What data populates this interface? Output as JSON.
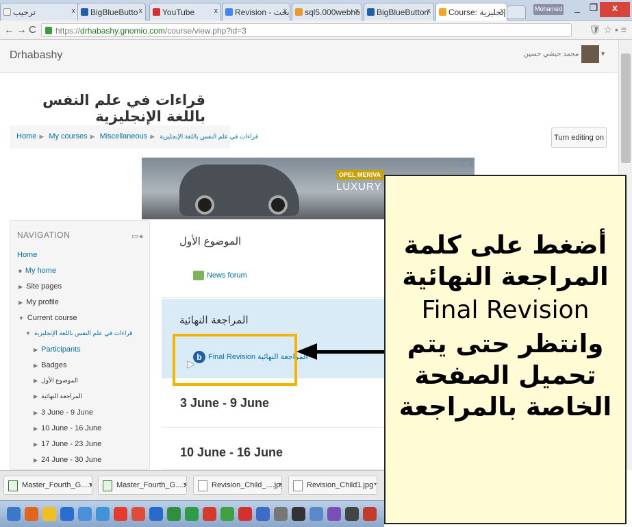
{
  "browser": {
    "tabs": [
      {
        "title": "ترحيب",
        "color": "#f0f0f0"
      },
      {
        "title": "BigBlueButto",
        "color": "#1e5fa8"
      },
      {
        "title": "YouTube",
        "color": "#d62f2f"
      },
      {
        "title": "Revision - بحث",
        "color": "#4285f4"
      },
      {
        "title": "sql5.000webho",
        "color": "#e89a2a"
      },
      {
        "title": "BigBlueButton",
        "color": "#1e5fa8"
      },
      {
        "title": "Course: إنجليزية",
        "color": "#f5a623"
      }
    ],
    "user": "Mohamed",
    "url_prefix": "https://",
    "url_host": "drhabashy.gnomio.com",
    "url_path": "/course/view.php?id=3"
  },
  "site": {
    "name": "Drhabashy",
    "user_name": "محمد حبشي حسين"
  },
  "course": {
    "title": "قراءات في علم النفس باللغة الإنجليزية",
    "breadcrumb": [
      "Home",
      "My courses",
      "Miscellaneous",
      "قراءات في علم النفس باللغة الإنجليزية"
    ],
    "edit_button": "Turn editing on"
  },
  "ad": {
    "brand": "OPEL MERIVA",
    "headline": "LUXURY FOR",
    "close": "ⓘ X"
  },
  "navigation": {
    "heading": "NAVIGATION",
    "home": "Home",
    "my_home": "My home",
    "site_pages": "Site pages",
    "my_profile": "My profile",
    "current_course": "Current course",
    "course_short": "قراءات في علم النفس باللغة الإنجليزية",
    "participants": "Participants",
    "badges": "Badges",
    "topic1": "الموضوع الأول",
    "topic2": "المراجعة النهائية",
    "week1": "3 June - 9 June",
    "week2": "10 June - 16 June",
    "week3": "17 June - 23 June",
    "week4": "24 June - 30 June"
  },
  "sections": {
    "s1_title": "الموضوع الأول",
    "s1_activity": "News forum",
    "s2_title": "المراجعة النهائية",
    "s2_activity": "Final Revision المراجعة النهائية",
    "s3_title": "3 June - 9 June",
    "s4_title": "10 June - 16 June"
  },
  "callout": {
    "line1": "أضغط على كلمة",
    "line2": "المراجعة النهائية",
    "line3": "Final Revision",
    "line4": "وانتظر حتى يتم",
    "line5": "تحميل الصفحة",
    "line6": "الخاصة بالمراجعة"
  },
  "downloads": [
    {
      "name": "Master_Fourth_G....xls",
      "type": "xls"
    },
    {
      "name": "Master_Fourth_G....xls",
      "type": "xls"
    },
    {
      "name": "Revision_Child_....jpg",
      "type": "jpg"
    },
    {
      "name": "Revision_Child1.jpg",
      "type": "jpg"
    }
  ],
  "taskbar_colors": [
    "#3a78c8",
    "#e2651f",
    "#f0c020",
    "#2a6fd0",
    "#4a90d9",
    "#3f93d6",
    "#e63a2e",
    "#e24a3a",
    "#2b6ac9",
    "#2f8f3f",
    "#2e9b48",
    "#d33b2a",
    "#3fa044",
    "#d4302f",
    "#3c6bc8",
    "#777777",
    "#333333",
    "#5a88c8",
    "#7b4fb6",
    "#444444",
    "#c23b2c"
  ]
}
